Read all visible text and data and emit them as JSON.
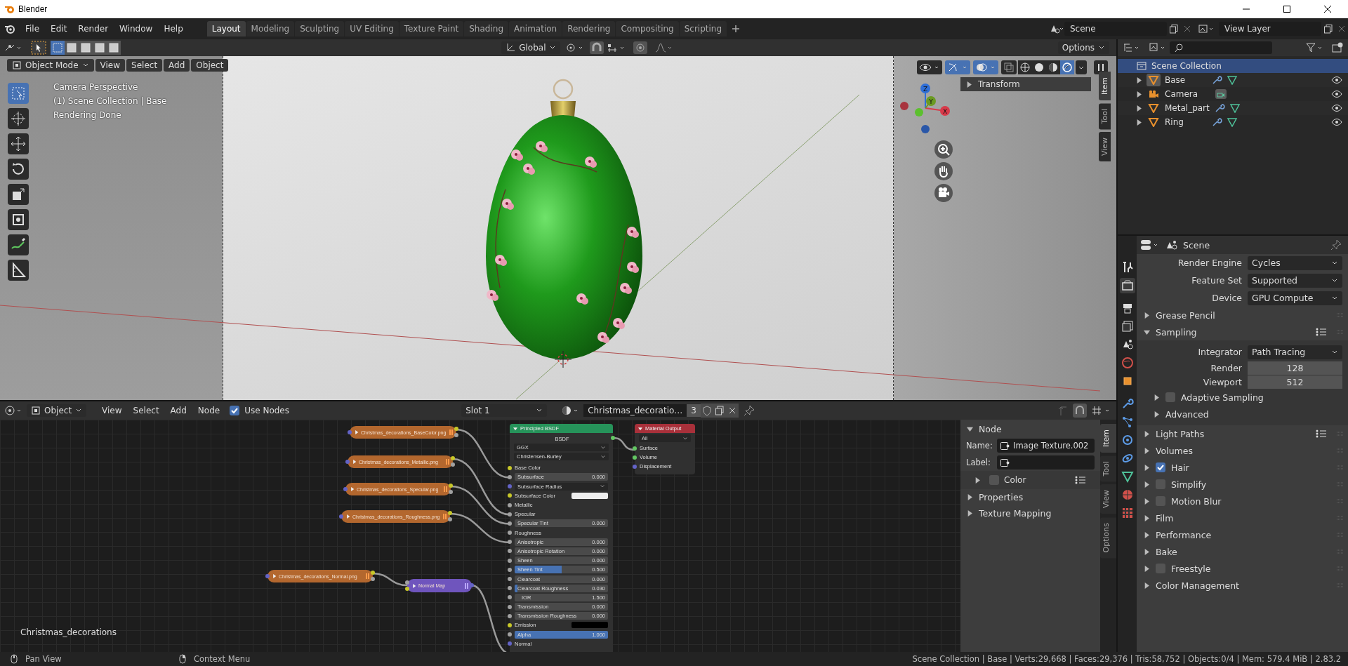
{
  "window": {
    "title": "Blender"
  },
  "menu": [
    "File",
    "Edit",
    "Render",
    "Window",
    "Help"
  ],
  "workspaces": [
    {
      "label": "Layout",
      "selected": true
    },
    {
      "label": "Modeling",
      "selected": false
    },
    {
      "label": "Sculpting",
      "selected": false
    },
    {
      "label": "UV Editing",
      "selected": false
    },
    {
      "label": "Texture Paint",
      "selected": false
    },
    {
      "label": "Shading",
      "selected": false
    },
    {
      "label": "Animation",
      "selected": false
    },
    {
      "label": "Rendering",
      "selected": false
    },
    {
      "label": "Compositing",
      "selected": false
    },
    {
      "label": "Scripting",
      "selected": false
    }
  ],
  "scene": {
    "name": "Scene"
  },
  "view_layer": {
    "name": "View Layer"
  },
  "tool_header": {
    "selection_modes": [
      {
        "selected": true
      },
      {
        "selected": false
      },
      {
        "selected": false
      },
      {
        "selected": false
      },
      {
        "selected": false
      }
    ],
    "orientation": "Global",
    "options": "Options"
  },
  "viewport": {
    "mode": "Object Mode",
    "menus": [
      "View",
      "Select",
      "Add",
      "Object"
    ],
    "info": [
      "Camera Perspective",
      "(1) Scene Collection | Base",
      "Rendering Done"
    ],
    "tools": [
      {
        "kind": "select",
        "selected": true
      },
      {
        "kind": "cursor",
        "selected": false
      },
      {
        "kind": "move",
        "selected": false
      },
      {
        "kind": "rotate",
        "selected": false
      },
      {
        "kind": "scale",
        "selected": false
      },
      {
        "kind": "transform",
        "selected": false
      },
      {
        "kind": "annotate",
        "selected": false
      },
      {
        "kind": "measure",
        "selected": false
      }
    ],
    "shading": [
      {
        "kind": "wireframe",
        "selected": false
      },
      {
        "kind": "solid",
        "selected": false
      },
      {
        "kind": "material",
        "selected": false
      },
      {
        "kind": "rendered",
        "selected": true
      }
    ],
    "gizmo": [
      "Z",
      "Y",
      "X"
    ],
    "sidebar": {
      "tabs": [
        {
          "label": "Item",
          "selected": true
        },
        {
          "label": "Tool",
          "selected": false
        },
        {
          "label": "View",
          "selected": false
        }
      ],
      "panel": "Transform",
      "expanded": false
    }
  },
  "outliner": {
    "root": {
      "name": "Scene Collection",
      "selected": true,
      "children": [
        {
          "name": "Base",
          "kind": "mesh",
          "active": true,
          "modifiers": true
        },
        {
          "name": "Camera",
          "kind": "camera",
          "active": false,
          "modifiers": false
        },
        {
          "name": "Metal_part",
          "kind": "mesh",
          "active": false,
          "modifiers": true
        },
        {
          "name": "Ring",
          "kind": "mesh",
          "active": false,
          "modifiers": true
        }
      ]
    }
  },
  "properties": {
    "context": "Scene",
    "tabs": [
      {
        "kind": "tool",
        "selected": false
      },
      {
        "kind": "render",
        "selected": true
      },
      {
        "kind": "output",
        "selected": false
      },
      {
        "kind": "view_layer",
        "selected": false
      },
      {
        "kind": "scene",
        "selected": false
      },
      {
        "kind": "world",
        "selected": false
      },
      {
        "kind": "object",
        "selected": false
      },
      {
        "kind": "modifiers",
        "selected": false
      },
      {
        "kind": "particles",
        "selected": false
      },
      {
        "kind": "physics",
        "selected": false
      },
      {
        "kind": "constraints",
        "selected": false
      },
      {
        "kind": "data",
        "selected": false
      },
      {
        "kind": "material",
        "selected": false
      },
      {
        "kind": "texture",
        "selected": false
      }
    ],
    "fields": [
      {
        "label": "Render Engine",
        "value": "Cycles"
      },
      {
        "label": "Feature Set",
        "value": "Supported"
      },
      {
        "label": "Device",
        "value": "GPU Compute"
      }
    ],
    "panels": [
      {
        "label": "Grease Pencil",
        "expanded": false
      },
      {
        "label": "Sampling",
        "expanded": true,
        "presets": true,
        "fields": [
          {
            "kind": "dropdown",
            "label": "Integrator",
            "value": "Path Tracing"
          },
          {
            "kind": "number",
            "label": "Render",
            "value": "128"
          },
          {
            "kind": "number",
            "label": "Viewport",
            "value": "512"
          }
        ],
        "subpanels": [
          {
            "label": "Adaptive Sampling",
            "checked": false
          },
          {
            "label": "Advanced"
          }
        ]
      },
      {
        "label": "Light Paths",
        "expanded": false,
        "presets": true
      },
      {
        "label": "Volumes",
        "expanded": false
      },
      {
        "label": "Hair",
        "expanded": false,
        "checked": true
      },
      {
        "label": "Simplify",
        "expanded": false,
        "checked": false
      },
      {
        "label": "Motion Blur",
        "expanded": false,
        "checked": false
      },
      {
        "label": "Film",
        "expanded": false
      },
      {
        "label": "Performance",
        "expanded": false
      },
      {
        "label": "Bake",
        "expanded": false
      },
      {
        "label": "Freestyle",
        "expanded": false,
        "checked": false
      },
      {
        "label": "Color Management",
        "expanded": false
      }
    ]
  },
  "node_editor": {
    "header": {
      "mode": "Object",
      "menus": [
        "View",
        "Select",
        "Add",
        "Node"
      ],
      "use_nodes": {
        "label": "Use Nodes",
        "checked": true
      },
      "slot": "Slot 1",
      "material": "Christmas_decoratio…",
      "users": "3"
    },
    "image_nodes": [
      {
        "label": "Christmas_decorations_BaseColor.png"
      },
      {
        "label": "Christmas_decorations_Metallic.png"
      },
      {
        "label": "Christmas_decorations_Specular.png"
      },
      {
        "label": "Christmas_decorations_Roughness.png"
      },
      {
        "label": "Christmas_decorations_Normal.png"
      }
    ],
    "normal_map": {
      "label": "Normal Map"
    },
    "principled": {
      "title": "Principled BSDF",
      "output": "BSDF",
      "dropdowns": [
        "GGX",
        "Christensen-Burley"
      ],
      "inputs": [
        {
          "label": "Base Color",
          "kind": "linked",
          "socket": {
            "color": "#c7c729"
          }
        },
        {
          "label": "Subsurface",
          "kind": "slider",
          "socket": {
            "color": "#a1a1a1"
          },
          "value": "0.000",
          "level": 0
        },
        {
          "label": "Subsurface Radius",
          "kind": "dropdown",
          "socket": {
            "color": "#6363c7"
          }
        },
        {
          "label": "Subsurface Color",
          "kind": "color",
          "socket": {
            "color": "#c7c729"
          },
          "color": "#eeeeee"
        },
        {
          "label": "Metallic",
          "kind": "linked",
          "socket": {
            "color": "#a1a1a1"
          }
        },
        {
          "label": "Specular",
          "kind": "linked",
          "socket": {
            "color": "#a1a1a1"
          }
        },
        {
          "label": "Specular Tint",
          "kind": "slider",
          "socket": {
            "color": "#a1a1a1"
          },
          "value": "0.000",
          "level": 0
        },
        {
          "label": "Roughness",
          "kind": "linked",
          "socket": {
            "color": "#a1a1a1"
          }
        },
        {
          "label": "Anisotropic",
          "kind": "slider",
          "socket": {
            "color": "#a1a1a1"
          },
          "value": "0.000",
          "level": 0
        },
        {
          "label": "Anisotropic Rotation",
          "kind": "slider",
          "socket": {
            "color": "#a1a1a1"
          },
          "value": "0.000",
          "level": 0
        },
        {
          "label": "Sheen",
          "kind": "slider",
          "socket": {
            "color": "#a1a1a1"
          },
          "value": "0.000",
          "level": 0
        },
        {
          "label": "Sheen Tint",
          "kind": "slider",
          "socket": {
            "color": "#a1a1a1"
          },
          "value": "0.500",
          "level": 0.5
        },
        {
          "label": "Clearcoat",
          "kind": "slider",
          "socket": {
            "color": "#a1a1a1"
          },
          "value": "0.000",
          "level": 0
        },
        {
          "label": "Clearcoat Roughness",
          "kind": "slider",
          "socket": {
            "color": "#a1a1a1"
          },
          "value": "0.030",
          "level": 0.03
        },
        {
          "label": "IOR",
          "kind": "number",
          "socket": {
            "color": "#a1a1a1"
          },
          "value": "1.500"
        },
        {
          "label": "Transmission",
          "kind": "slider",
          "socket": {
            "color": "#a1a1a1"
          },
          "value": "0.000",
          "level": 0
        },
        {
          "label": "Transmission Roughness",
          "kind": "slider",
          "socket": {
            "color": "#a1a1a1"
          },
          "value": "0.000",
          "level": 0
        },
        {
          "label": "Emission",
          "kind": "color",
          "socket": {
            "color": "#c7c729"
          },
          "color": "#000000"
        },
        {
          "label": "Alpha",
          "kind": "slider",
          "socket": {
            "color": "#a1a1a1"
          },
          "value": "1.000",
          "level": 1
        },
        {
          "label": "Normal",
          "kind": "linked",
          "socket": {
            "color": "#6363c7"
          }
        }
      ]
    },
    "output_node": {
      "title": "Material Output",
      "target": "All",
      "inputs": [
        {
          "label": "Surface",
          "socket": {
            "color": "#63c763"
          }
        },
        {
          "label": "Volume",
          "socket": {
            "color": "#63c763"
          }
        },
        {
          "label": "Displacement",
          "socket": {
            "color": "#6363c7"
          }
        }
      ]
    },
    "material_label": "Christmas_decorations",
    "sidebar": {
      "tabs": [
        {
          "label": "Item",
          "selected": true
        },
        {
          "label": "Tool",
          "selected": false
        },
        {
          "label": "View",
          "selected": false
        },
        {
          "label": "Options",
          "selected": false
        }
      ],
      "panel": "Node",
      "name_label": "Name:",
      "name": "Image Texture.002",
      "label_label": "Label:",
      "color": {
        "label": "Color",
        "checked": false
      },
      "subpanels": [
        "Properties",
        "Texture Mapping"
      ]
    }
  },
  "status_bar": {
    "hints": [
      {
        "kind": "middle",
        "label": "Pan View"
      },
      {
        "kind": "right",
        "label": "Context Menu"
      }
    ],
    "info": "Scene Collection | Base | Verts:29,668 | Faces:29,376 | Tris:58,752 | Objects:0/4 | Mem: 579.4 MiB | 2.83.2"
  }
}
